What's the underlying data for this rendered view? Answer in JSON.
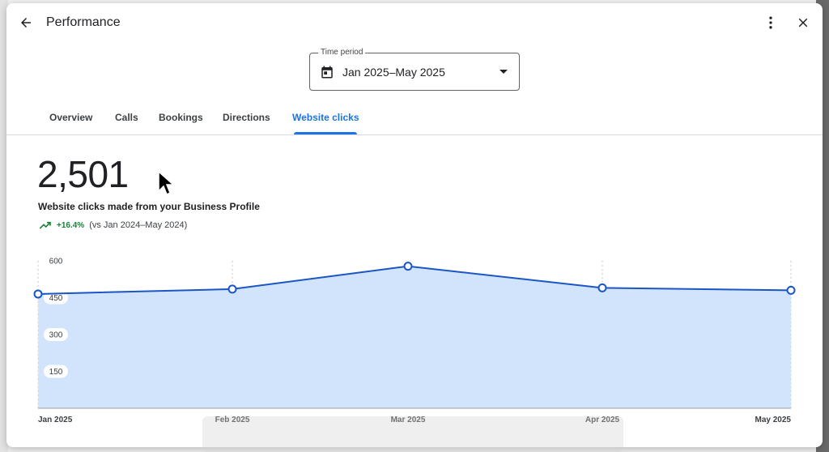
{
  "header": {
    "title": "Performance",
    "back_icon": "arrow-back-icon",
    "more_icon": "more-vert-icon",
    "close_icon": "close-icon"
  },
  "time_period": {
    "label": "Time period",
    "value": "Jan 2025–May 2025",
    "icon": "calendar-icon"
  },
  "tabs": [
    {
      "label": "Overview",
      "active": false
    },
    {
      "label": "Calls",
      "active": false
    },
    {
      "label": "Bookings",
      "active": false
    },
    {
      "label": "Directions",
      "active": false
    },
    {
      "label": "Website clicks",
      "active": true
    }
  ],
  "metric": {
    "total": "2,501",
    "description": "Website clicks made from your Business Profile",
    "delta": "+16.4%",
    "comparison": "(vs Jan 2024–May 2024)",
    "delta_icon": "trending-up-icon"
  },
  "colors": {
    "accent": "#1a73e8",
    "line": "#1a56c4",
    "area": "#d2e3fc",
    "positive": "#188038"
  },
  "chart_data": {
    "type": "area",
    "categories": [
      "Jan 2025",
      "Feb 2025",
      "Mar 2025",
      "Apr 2025",
      "May 2025"
    ],
    "values": [
      465,
      485,
      578,
      490,
      480
    ],
    "yticks": [
      "600",
      "450",
      "300",
      "150"
    ],
    "ylim": [
      0,
      600
    ],
    "title": "",
    "xlabel": "",
    "ylabel": ""
  }
}
